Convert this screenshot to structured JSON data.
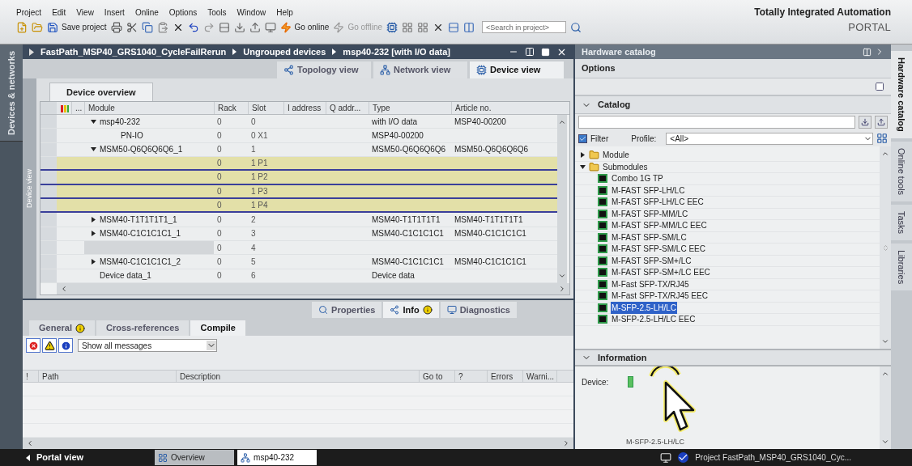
{
  "menu": [
    "Project",
    "Edit",
    "View",
    "Insert",
    "Online",
    "Options",
    "Tools",
    "Window",
    "Help"
  ],
  "toolbar": {
    "save": "Save project",
    "go_online": {
      "label": "Go online",
      "disabled": false
    },
    "go_offline": {
      "label": "Go offline",
      "disabled": true
    },
    "search": {
      "placeholder": "<Search in project>"
    }
  },
  "brand": {
    "line1": "Totally Integrated Automation",
    "line2": "PORTAL"
  },
  "left_tabs": [
    "Devices & networks"
  ],
  "editor": {
    "breadcrumb": [
      "FastPath_MSP40_GRS1040_CycleFailRerun",
      "Ungrouped devices",
      "msp40-232 [with I/O data]"
    ],
    "views": [
      {
        "label": "Topology view",
        "selected": false
      },
      {
        "label": "Network view",
        "selected": false
      },
      {
        "label": "Device view",
        "selected": true
      }
    ],
    "side_label": "Device view",
    "overview_tab": "Device overview",
    "columns": [
      "...",
      "Module",
      "Rack",
      "Slot",
      "I address",
      "Q addr...",
      "Type",
      "Article no."
    ],
    "rows": [
      {
        "module": "msp40-232",
        "rack": "0",
        "slot": "0",
        "type": "with I/O data",
        "article": "MSP40-00200",
        "kind": "node",
        "expanded": true,
        "highlighted": false,
        "children": [
          {
            "module": "PN-IO",
            "rack": "0",
            "slot": "0 X1",
            "type": "MSP40-00200",
            "kind": "leaf",
            "highlighted": false
          }
        ]
      },
      {
        "module": "MSM50-Q6Q6Q6Q6_1",
        "rack": "0",
        "slot": "1",
        "type": "MSM50-Q6Q6Q6Q6",
        "article": "MSM50-Q6Q6Q6Q6",
        "kind": "node",
        "expanded": true,
        "highlighted": false,
        "children": [
          {
            "rack": "0",
            "slot": "1 P1",
            "highlighted": true
          },
          {
            "rack": "0",
            "slot": "1 P2",
            "highlighted": true
          },
          {
            "rack": "0",
            "slot": "1 P3",
            "highlighted": true
          },
          {
            "rack": "0",
            "slot": "1 P4",
            "highlighted": true
          }
        ]
      },
      {
        "module": "MSM40-T1T1T1T1_1",
        "rack": "0",
        "slot": "2",
        "type": "MSM40-T1T1T1T1",
        "article": "MSM40-T1T1T1T1",
        "kind": "node",
        "expanded": false,
        "highlighted": false
      },
      {
        "module": "MSM40-C1C1C1C1_1",
        "rack": "0",
        "slot": "3",
        "type": "MSM40-C1C1C1C1",
        "article": "MSM40-C1C1C1C1",
        "kind": "node",
        "expanded": false,
        "highlighted": false
      },
      {
        "rack": "0",
        "slot": "4",
        "kind": "empty",
        "highlighted": false
      },
      {
        "module": "MSM40-C1C1C1C1_2",
        "rack": "0",
        "slot": "5",
        "type": "MSM40-C1C1C1C1",
        "article": "MSM40-C1C1C1C1",
        "kind": "node",
        "expanded": false,
        "highlighted": false
      },
      {
        "module": "Device data_1",
        "rack": "0",
        "slot": "6",
        "type": "Device data",
        "kind": "leaf",
        "highlighted": false
      }
    ]
  },
  "inspector": {
    "tabs": [
      {
        "label": "Properties",
        "selected": false
      },
      {
        "label": "Info",
        "selected": true
      },
      {
        "label": "Diagnostics",
        "selected": false
      }
    ],
    "subtabs": [
      {
        "label": "General",
        "selected": false
      },
      {
        "label": "Cross-references",
        "selected": false
      },
      {
        "label": "Compile",
        "selected": true
      }
    ],
    "filter": "Show all messages",
    "columns": [
      "!",
      "Path",
      "Description",
      "Go to",
      "?",
      "Errors",
      "Warni..."
    ]
  },
  "catalog": {
    "title": "Hardware catalog",
    "options": "Options",
    "heading": "Catalog",
    "filter": {
      "label": "Filter",
      "checked": true
    },
    "profile_label": "Profile:",
    "profile": "<All>",
    "tree": [
      {
        "label": "Module",
        "expanded": false
      },
      {
        "label": "Submodules",
        "expanded": true,
        "children": [
          {
            "label": "Combo 1G TP",
            "selected": false
          },
          {
            "label": "M-FAST SFP-LH/LC",
            "selected": false
          },
          {
            "label": "M-FAST SFP-LH/LC EEC",
            "selected": false
          },
          {
            "label": "M-FAST SFP-MM/LC",
            "selected": false
          },
          {
            "label": "M-FAST SFP-MM/LC EEC",
            "selected": false
          },
          {
            "label": "M-FAST SFP-SM/LC",
            "selected": false
          },
          {
            "label": "M-FAST SFP-SM/LC EEC",
            "selected": false
          },
          {
            "label": "M-FAST SFP-SM+/LC",
            "selected": false
          },
          {
            "label": "M-FAST SFP-SM+/LC EEC",
            "selected": false
          },
          {
            "label": "M-Fast SFP-TX/RJ45",
            "selected": false
          },
          {
            "label": "M-Fast SFP-TX/RJ45 EEC",
            "selected": false
          },
          {
            "label": "M-SFP-2.5-LH/LC",
            "selected": true
          },
          {
            "label": "M-SFP-2.5-LH/LC EEC",
            "selected": false
          }
        ]
      }
    ],
    "information": "Information",
    "device_label": "Device:",
    "device_caption": "M-SFP-2.5-LH/LC"
  },
  "right_tabs": [
    {
      "label": "Hardware catalog",
      "selected": true
    },
    {
      "label": "Online tools",
      "selected": false
    },
    {
      "label": "Tasks",
      "selected": false
    },
    {
      "label": "Libraries",
      "selected": false
    }
  ],
  "taskbar": {
    "portal": "Portal view",
    "tabs": [
      {
        "label": "Overview",
        "selected": false
      },
      {
        "label": "msp40-232",
        "selected": true
      }
    ],
    "status": "Project FastPath_MSP40_GRS1040_Cyc..."
  }
}
